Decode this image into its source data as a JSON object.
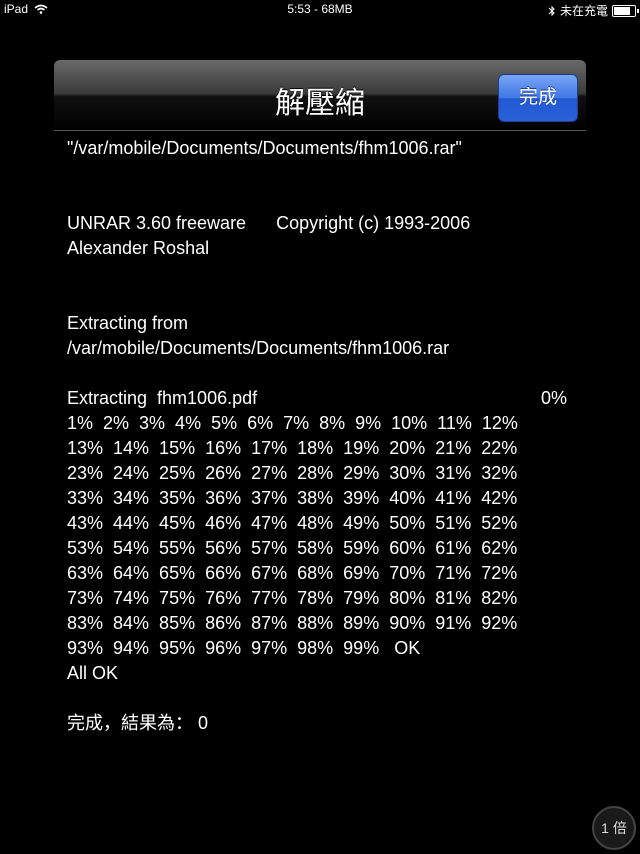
{
  "status_bar": {
    "device": "iPad",
    "center": "5:53 - 68MB",
    "charging": "未在充電",
    "battery_level": 0.9
  },
  "nav": {
    "title": "解壓縮",
    "done_label": "完成"
  },
  "output": {
    "path_quoted": "\"/var/mobile/Documents/Documents/fhm1006.rar\"",
    "version": "UNRAR 3.60 freeware",
    "copyright": "Copyright (c) 1993-2006",
    "author": "Alexander Roshal",
    "extracting_from": "Extracting from",
    "path": "/var/mobile/Documents/Documents/fhm1006.rar",
    "extracting_file": "Extracting  fhm1006.pdf",
    "start_percent": "0%",
    "progress_lines": [
      "1%  2%  3%  4%  5%  6%  7%  8%  9%  10%  11%  12%",
      "13%  14%  15%  16%  17%  18%  19%  20%  21%  22%",
      "23%  24%  25%  26%  27%  28%  29%  30%  31%  32%",
      "33%  34%  35%  36%  37%  38%  39%  40%  41%  42%",
      "43%  44%  45%  46%  47%  48%  49%  50%  51%  52%",
      "53%  54%  55%  56%  57%  58%  59%  60%  61%  62%",
      "63%  64%  65%  66%  67%  68%  69%  70%  71%  72%",
      "73%  74%  75%  76%  77%  78%  79%  80%  81%  82%",
      "83%  84%  85%  86%  87%  88%  89%  90%  91%  92%",
      "93%  94%  95%  96%  97%  98%  99%   OK"
    ],
    "all_ok": "All OK",
    "result": "完成，結果為： 0"
  },
  "zoom": {
    "label": "1 倍"
  }
}
